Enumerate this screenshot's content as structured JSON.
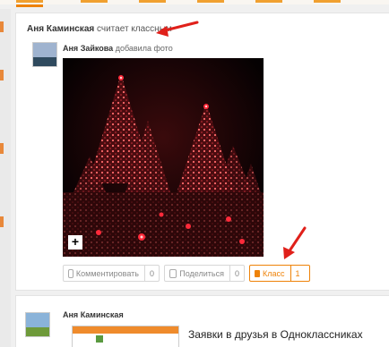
{
  "feed_item": {
    "actor_name": "Аня Каминская",
    "actor_action": "считает классным",
    "author_name": "Аня Зайкова",
    "author_action": "добавила фото",
    "photo_overlay": "+",
    "actions": {
      "comment_label": "Комментировать",
      "comment_count": "0",
      "share_label": "Поделиться",
      "share_count": "0",
      "class_label": "Класс",
      "class_count": "1"
    }
  },
  "next_item": {
    "author_name": "Аня Каминская",
    "link_title": "Заявки в друзья в Одноклассниках"
  },
  "colors": {
    "accent": "#ee8208",
    "annotation_red": "#e0201a"
  },
  "icons": [
    "comment-icon",
    "share-icon",
    "thumbs-up-icon",
    "expand-plus-icon"
  ]
}
